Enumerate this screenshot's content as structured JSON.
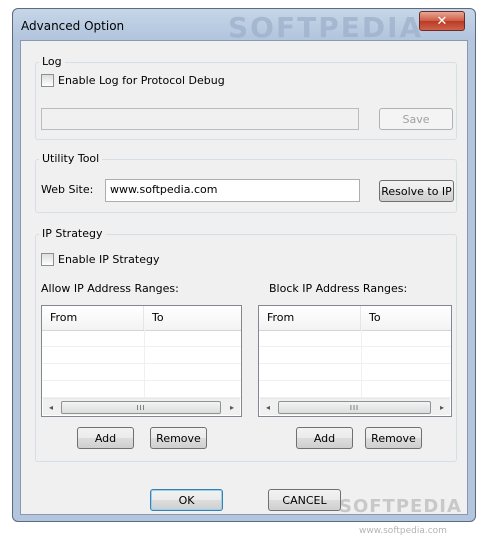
{
  "window": {
    "title": "Advanced Option",
    "watermark": "SOFTPEDIA",
    "close_glyph": "✕"
  },
  "log": {
    "legend": "Log",
    "checkbox_label": "Enable Log for Protocol Debug",
    "checked": false,
    "path_value": "",
    "save_label": "Save"
  },
  "utility": {
    "legend": "Utility Tool",
    "website_label": "Web Site:",
    "website_value": "www.softpedia.com",
    "resolve_label": "Resolve to IP"
  },
  "ip_strategy": {
    "legend": "IP Strategy",
    "checkbox_label": "Enable IP Strategy",
    "checked": false,
    "allow": {
      "title": "Allow IP Address Ranges:",
      "columns": [
        "From",
        "To"
      ],
      "scroll_left": "◂",
      "scroll_right": "▸",
      "thumb": "III",
      "add_label": "Add",
      "remove_label": "Remove"
    },
    "block": {
      "title": "Block IP Address Ranges:",
      "columns": [
        "From",
        "To"
      ],
      "scroll_left": "◂",
      "scroll_right": "▸",
      "thumb": "III",
      "add_label": "Add",
      "remove_label": "Remove"
    }
  },
  "footer": {
    "ok_label": "OK",
    "cancel_label": "CANCEL",
    "watermark": "SOFTPEDIA",
    "watermark_url": "www.softpedia.com"
  }
}
